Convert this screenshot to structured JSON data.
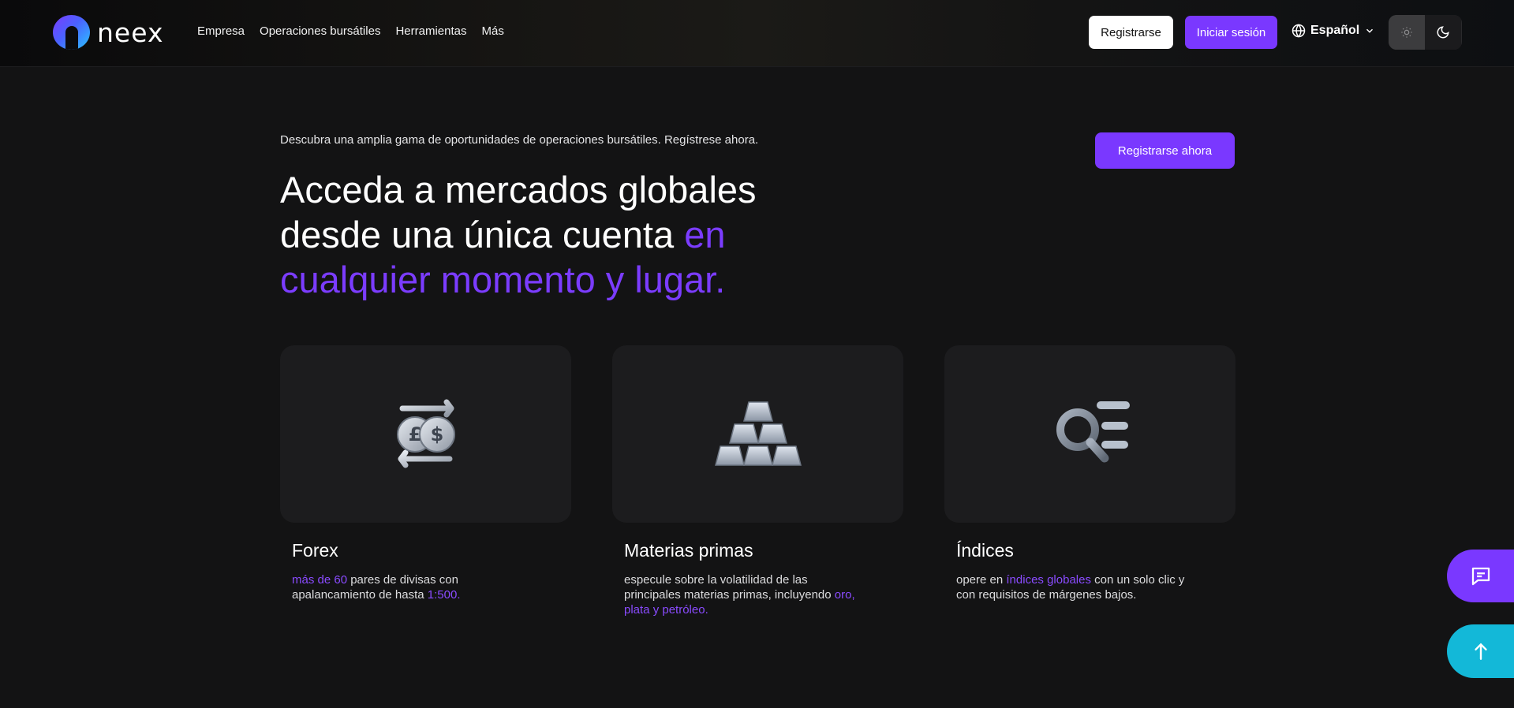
{
  "header": {
    "logo_text": "neex",
    "nav": [
      "Empresa",
      "Operaciones bursátiles",
      "Herramientas",
      "Más"
    ],
    "register_label": "Registrarse",
    "login_label": "Iniciar sesión",
    "language": "Español"
  },
  "hero": {
    "subtitle": "Descubra una amplia gama de oportunidades de operaciones bursátiles. Regístrese ahora.",
    "title_plain": "Acceda a mercados globales desde una única cuenta ",
    "title_accent": "en cualquier momento y lugar.",
    "cta_label": "Registrarse ahora"
  },
  "cards": [
    {
      "title": "Forex",
      "icon": "currency-exchange-icon",
      "desc": [
        {
          "text": "más de 60",
          "hl": true
        },
        {
          "text": " pares de divisas con apalancamiento de hasta ",
          "hl": false
        },
        {
          "text": "1:500.",
          "hl": true
        }
      ]
    },
    {
      "title": "Materias primas",
      "icon": "gold-bars-icon",
      "desc": [
        {
          "text": "especule sobre la volatilidad de las principales materias primas, incluyendo ",
          "hl": false
        },
        {
          "text": "oro, plata y petróleo.",
          "hl": true
        }
      ]
    },
    {
      "title": "Índices",
      "icon": "index-search-icon",
      "desc": [
        {
          "text": "opere en ",
          "hl": false
        },
        {
          "text": "índices globales",
          "hl": true
        },
        {
          "text": " con un solo clic y con requisitos de márgenes bajos.",
          "hl": false
        }
      ]
    }
  ],
  "colors": {
    "accent": "#7a38ff",
    "background": "#131314",
    "card": "#1c1c1e",
    "scroll_top": "#13b8d8"
  }
}
